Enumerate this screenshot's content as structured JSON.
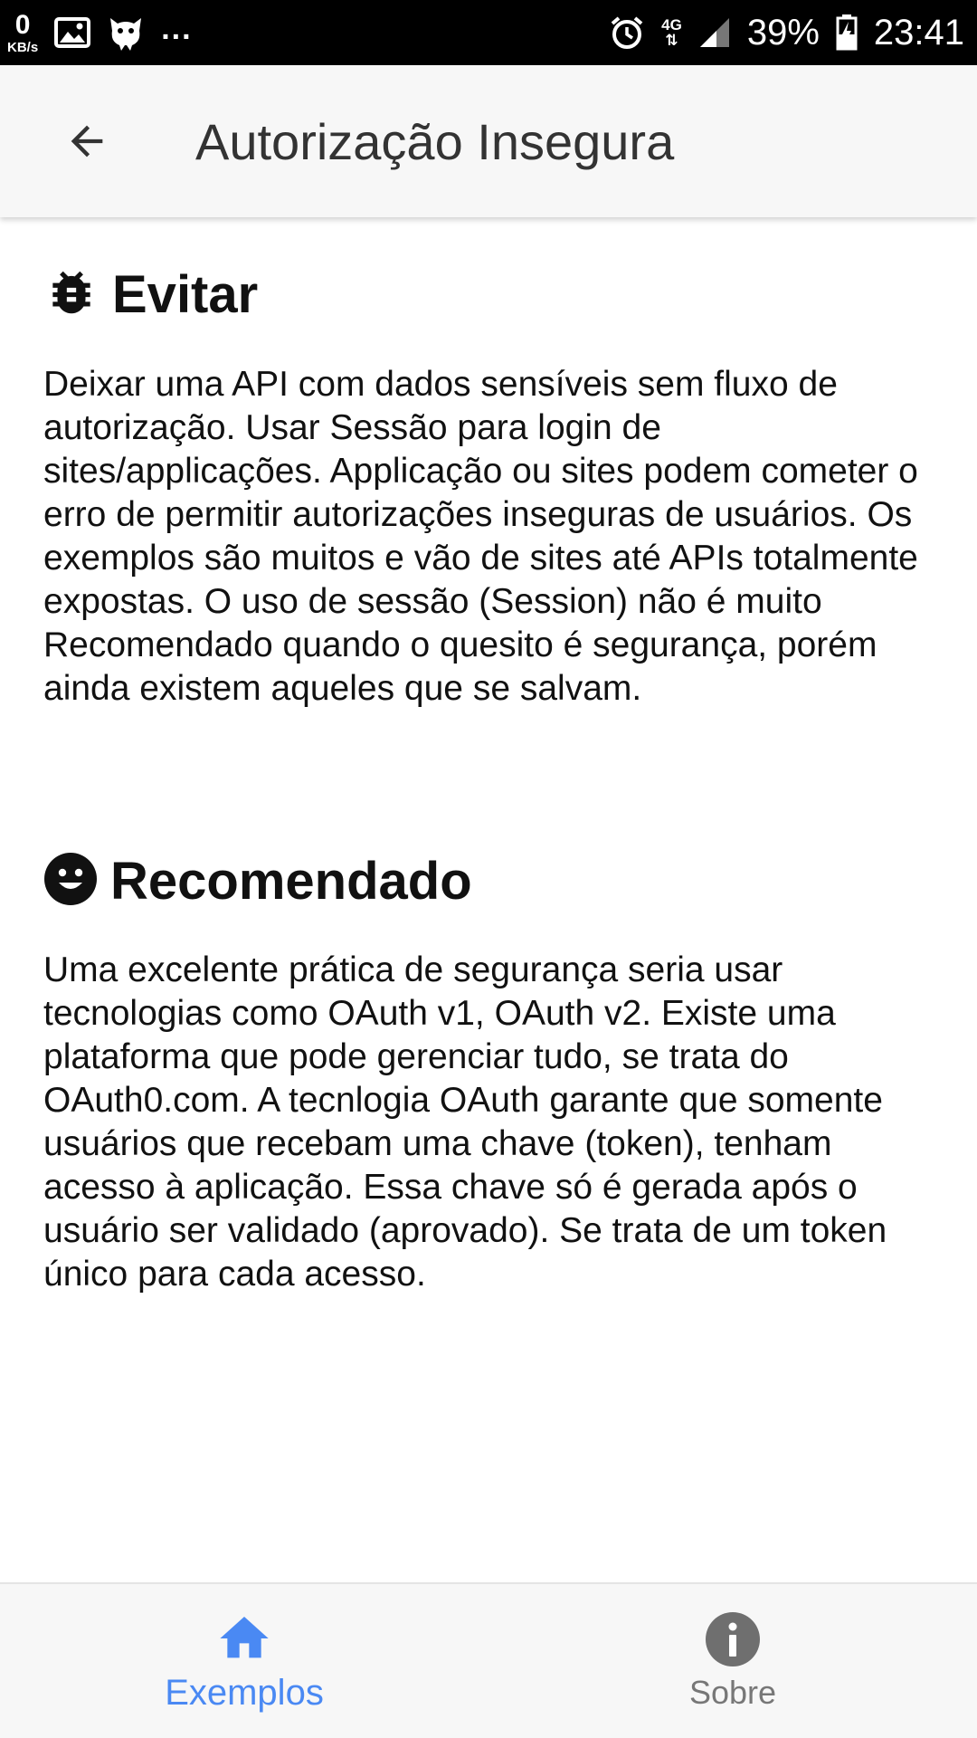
{
  "status_bar": {
    "net_speed_value": "0",
    "net_speed_unit": "KB/s",
    "overflow": "...",
    "network_type": "4G",
    "battery_percent": "39%",
    "time": "23:41"
  },
  "app_bar": {
    "title": "Autorização Insegura"
  },
  "sections": [
    {
      "icon": "bug-icon",
      "title": "Evitar",
      "body": "Deixar uma API com dados sensíveis sem fluxo de autorização. Usar Sessão para login de sites/applicações. Applicação ou sites podem cometer o erro de permitir autorizações inseguras de usuários. Os exemplos são muitos e vão de sites até APIs totalmente expostas. O uso de sessão (Session) não é muito Recomendado quando o quesito é segurança, porém ainda existem aqueles que se salvam."
    },
    {
      "icon": "smile-icon",
      "title": "Recomendado",
      "body": "Uma excelente prática de segurança seria usar tecnologias como OAuth v1, OAuth v2. Existe uma plataforma que pode gerenciar tudo, se trata do OAuth0.com. A tecnlogia OAuth garante que somente usuários que recebam uma chave (token), tenham acesso à aplicação. Essa chave só é gerada após o usuário ser validado (aprovado). Se trata de um token único para cada acesso."
    }
  ],
  "bottom_nav": {
    "items": [
      {
        "label": "Exemplos",
        "icon": "home-icon",
        "active": true
      },
      {
        "label": "Sobre",
        "icon": "info-icon",
        "active": false
      }
    ]
  },
  "colors": {
    "accent": "#4a89f3",
    "inactive": "#777777",
    "app_bar_bg": "#f7f7f7"
  }
}
